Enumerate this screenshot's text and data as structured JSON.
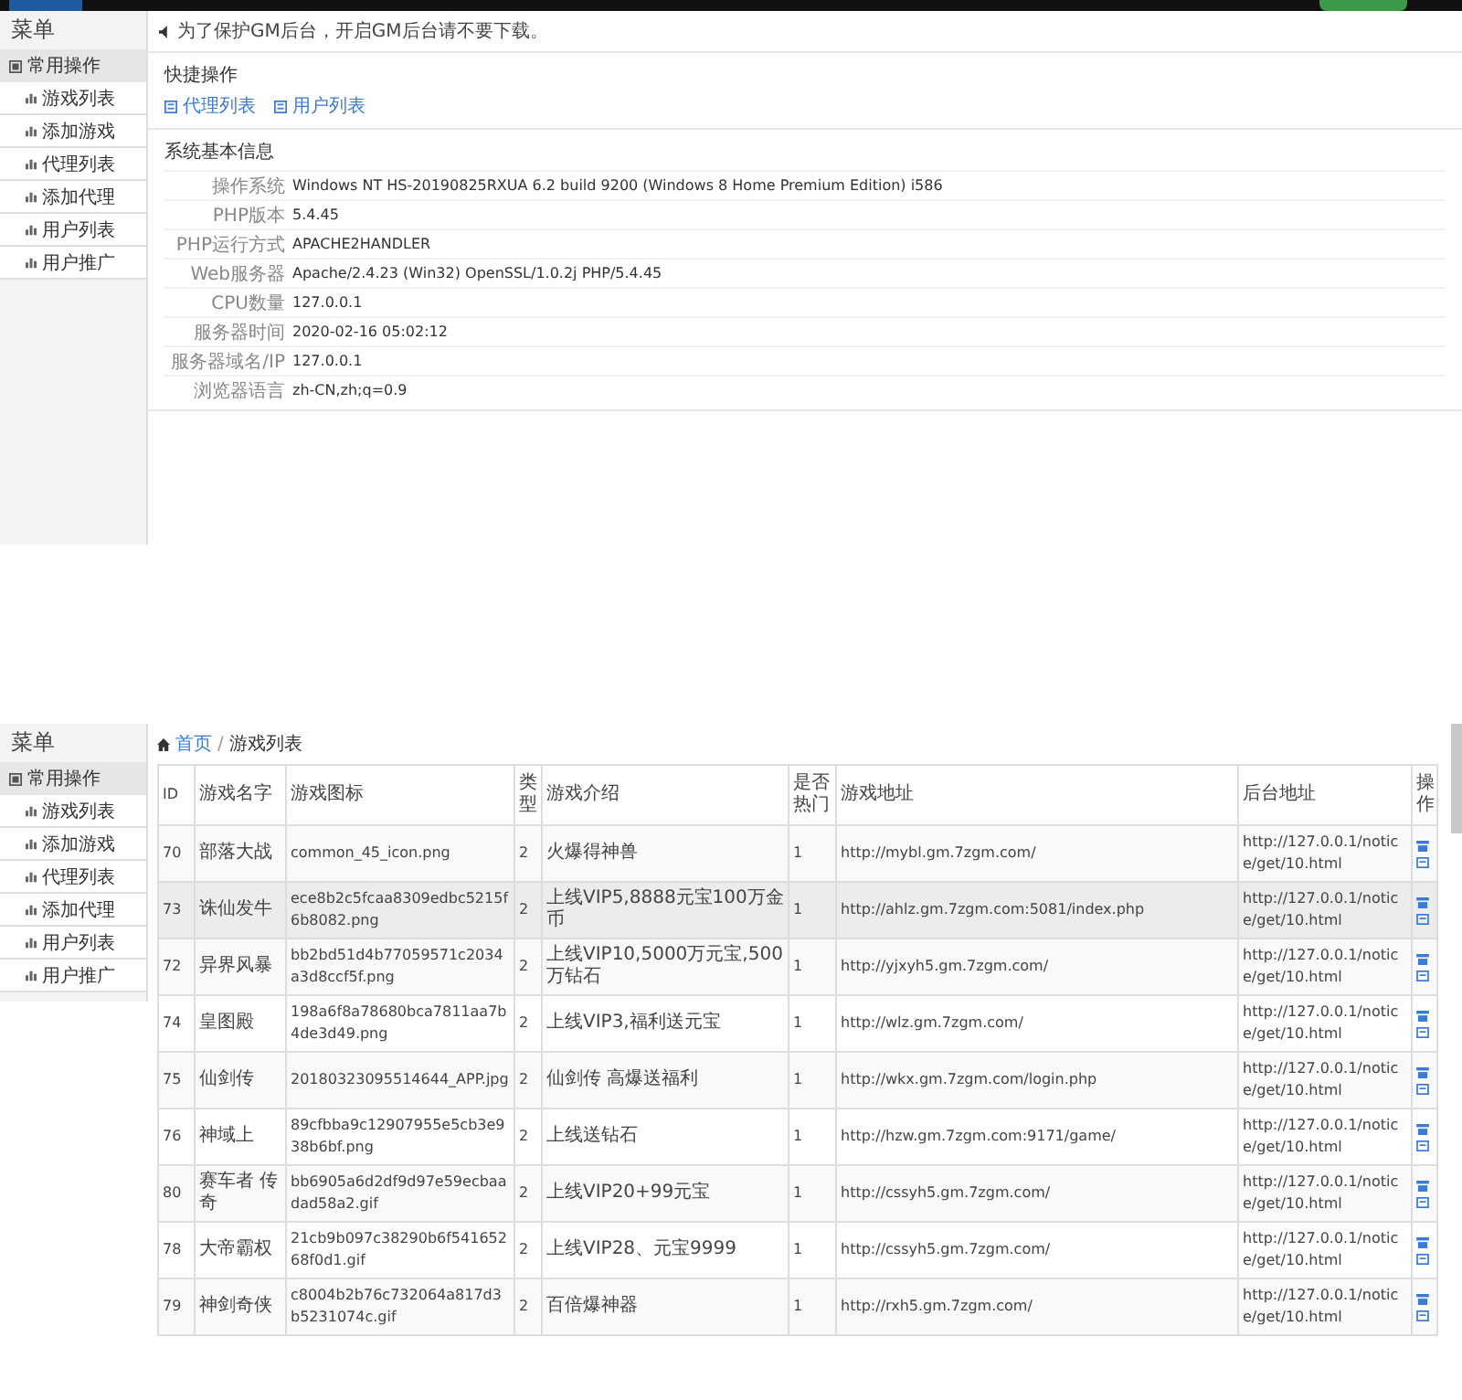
{
  "dashboard": {
    "sidebar": {
      "title": "菜单",
      "group": "常用操作",
      "items": [
        "游戏列表",
        "添加游戏",
        "代理列表",
        "添加代理",
        "用户列表",
        "用户推广"
      ]
    },
    "notice": "为了保护GM后台，开启GM后台请不要下载。",
    "quick_actions": {
      "title": "快捷操作",
      "links": [
        "代理列表",
        "用户列表"
      ]
    },
    "system_info": {
      "title": "系统基本信息",
      "rows": [
        {
          "label": "操作系统",
          "value": "Windows NT HS-20190825RXUA 6.2 build 9200 (Windows 8 Home Premium Edition) i586"
        },
        {
          "label": "PHP版本",
          "value": "5.4.45"
        },
        {
          "label": "PHP运行方式",
          "value": "APACHE2HANDLER"
        },
        {
          "label": "Web服务器",
          "value": "Apache/2.4.23 (Win32) OpenSSL/1.0.2j PHP/5.4.45"
        },
        {
          "label": "CPU数量",
          "value": "127.0.0.1"
        },
        {
          "label": "服务器时间",
          "value": "2020-02-16 05:02:12"
        },
        {
          "label": "服务器域名/IP",
          "value": "127.0.0.1"
        },
        {
          "label": "浏览器语言",
          "value": "zh-CN,zh;q=0.9"
        }
      ]
    }
  },
  "game_list": {
    "sidebar": {
      "title": "菜单",
      "group": "常用操作",
      "items": [
        "游戏列表",
        "添加游戏",
        "代理列表",
        "添加代理",
        "用户列表",
        "用户推广"
      ]
    },
    "breadcrumb": [
      "首页",
      "游戏列表"
    ],
    "breadcrumb_separator": "/",
    "table": {
      "columns": [
        "ID",
        "游戏名字",
        "游戏图标",
        "类型",
        "游戏介绍",
        "是否热门",
        "游戏地址",
        "后台地址",
        "操作"
      ],
      "rows": [
        [
          "70",
          "部落大战",
          "common_45_icon.png",
          "2",
          "火爆得神兽",
          "1",
          "http://mybl.gm.7zgm.com/",
          "http://127.0.0.1/notice/get/10.html"
        ],
        [
          "73",
          "诛仙发牛",
          "ece8b2c5fcaa8309edbc5215f6b8082.png",
          "2",
          "上线VIP5,8888元宝100万金币",
          "1",
          "http://ahlz.gm.7zgm.com:5081/index.php",
          "http://127.0.0.1/notice/get/10.html"
        ],
        [
          "72",
          "异界风暴",
          "bb2bd51d4b77059571c2034a3d8ccf5f.png",
          "2",
          "上线VIP10,5000万元宝,500万钻石",
          "1",
          "http://yjxyh5.gm.7zgm.com/",
          "http://127.0.0.1/notice/get/10.html"
        ],
        [
          "74",
          "皇图殿",
          "198a6f8a78680bca7811aa7b4de3d49.png",
          "2",
          "上线VIP3,福利送元宝",
          "1",
          "http://wlz.gm.7zgm.com/",
          "http://127.0.0.1/notice/get/10.html"
        ],
        [
          "75",
          "仙剑传",
          "20180323095514644_APP.jpg",
          "2",
          "仙剑传 高爆送福利",
          "1",
          "http://wkx.gm.7zgm.com/login.php",
          "http://127.0.0.1/notice/get/10.html"
        ],
        [
          "76",
          "神域上",
          "89cfbba9c12907955e5cb3e938b6bf.png",
          "2",
          "上线送钻石",
          "1",
          "http://hzw.gm.7zgm.com:9171/game/",
          "http://127.0.0.1/notice/get/10.html"
        ],
        [
          "80",
          "赛车者 传奇",
          "bb6905a6d2df9d97e59ecbaadad58a2.gif",
          "2",
          "上线VIP20+99元宝",
          "1",
          "http://cssyh5.gm.7zgm.com/",
          "http://127.0.0.1/notice/get/10.html"
        ],
        [
          "78",
          "大帝霸权",
          "21cb9b097c38290b6f54165268f0d1.gif",
          "2",
          "上线VIP28、元宝9999",
          "1",
          "http://cssyh5.gm.7zgm.com/",
          "http://127.0.0.1/notice/get/10.html"
        ],
        [
          "79",
          "神剑奇侠",
          "c8004b2b76c732064a817d3b5231074c.gif",
          "2",
          "百倍爆神器",
          "1",
          "http://rxh5.gm.7zgm.com/",
          "http://127.0.0.1/notice/get/10.html"
        ]
      ]
    }
  }
}
